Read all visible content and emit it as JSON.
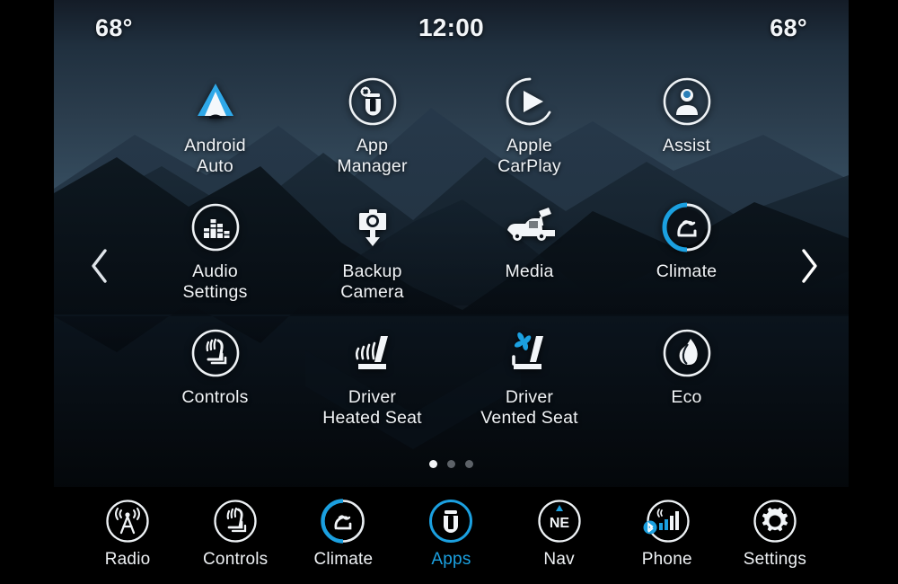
{
  "status": {
    "left_temp": "68°",
    "clock": "12:00",
    "right_temp": "68°"
  },
  "nav": {
    "prev_label": "‹",
    "next_label": "›",
    "prev_icon": "chevron-left-icon",
    "next_icon": "chevron-right-icon"
  },
  "apps": [
    {
      "label": "Android\nAuto",
      "icon": "android-auto-icon",
      "circle": false,
      "accent": "#2fa8e8"
    },
    {
      "label": "App\nManager",
      "icon": "app-manager-icon",
      "circle": true,
      "accent": ""
    },
    {
      "label": "Apple\nCarPlay",
      "icon": "apple-carplay-icon",
      "circle": true,
      "accent": ""
    },
    {
      "label": "Assist",
      "icon": "assist-icon",
      "circle": true,
      "accent": ""
    },
    {
      "label": "Audio\nSettings",
      "icon": "audio-settings-icon",
      "circle": true,
      "accent": ""
    },
    {
      "label": "Backup\nCamera",
      "icon": "backup-camera-icon",
      "circle": false,
      "accent": ""
    },
    {
      "label": "Media",
      "icon": "media-truck-icon",
      "circle": false,
      "accent": ""
    },
    {
      "label": "Climate",
      "icon": "climate-icon",
      "circle": true,
      "accent": "#1ba0e0"
    },
    {
      "label": "Controls",
      "icon": "controls-icon",
      "circle": true,
      "accent": ""
    },
    {
      "label": "Driver\nHeated Seat",
      "icon": "heated-seat-icon",
      "circle": false,
      "accent": ""
    },
    {
      "label": "Driver\nVented Seat",
      "icon": "vented-seat-icon",
      "circle": false,
      "accent": "#1ba0e0"
    },
    {
      "label": "Eco",
      "icon": "eco-leaf-icon",
      "circle": true,
      "accent": ""
    }
  ],
  "pagination": {
    "total": 3,
    "active_index": 0
  },
  "dock": [
    {
      "label": "Radio",
      "icon": "radio-tower-icon",
      "active": false
    },
    {
      "label": "Controls",
      "icon": "controls-icon",
      "active": false
    },
    {
      "label": "Climate",
      "icon": "climate-icon",
      "active": false
    },
    {
      "label": "Apps",
      "icon": "uconnect-u-icon",
      "active": true
    },
    {
      "label": "Nav",
      "icon": "compass-ne-icon",
      "active": false
    },
    {
      "label": "Phone",
      "icon": "phone-signal-icon",
      "active": false
    },
    {
      "label": "Settings",
      "icon": "gear-icon",
      "active": false
    }
  ],
  "colors": {
    "accent_blue": "#1ba0e0",
    "android_blue": "#2fa8e8",
    "text_white": "#f0f3f6",
    "dock_background": "#000000"
  }
}
